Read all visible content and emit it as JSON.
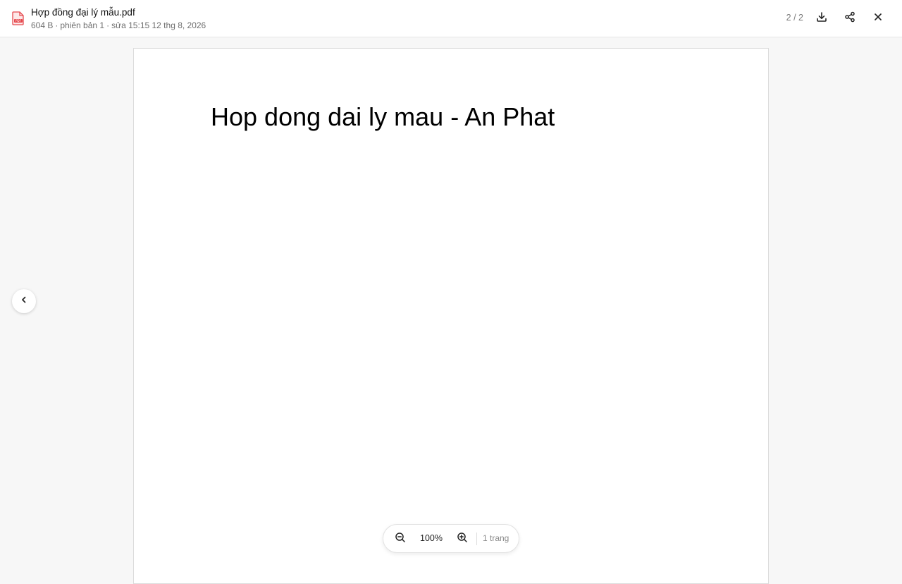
{
  "header": {
    "file_name": "Hợp đồng đại lý mẫu.pdf",
    "file_size": "604 B",
    "version": "phiên bản 1",
    "modified": "sửa 15:15 12 thg 8, 2026",
    "separator": "·",
    "page_position": "2 / 2",
    "icons": {
      "file": "pdf-file-icon",
      "download": "download-icon",
      "share": "share-icon",
      "close": "close-icon"
    }
  },
  "document": {
    "heading": "Hop dong dai ly mau - An Phat"
  },
  "navigation": {
    "prev_icon": "chevron-left-icon"
  },
  "zoom": {
    "level": "100%",
    "page_count": "1 trang",
    "zoom_out_icon": "zoom-out-icon",
    "zoom_in_icon": "zoom-in-icon"
  },
  "colors": {
    "pdf_icon": "#e5484d",
    "background": "#f7f7f7",
    "page": "#ffffff"
  }
}
